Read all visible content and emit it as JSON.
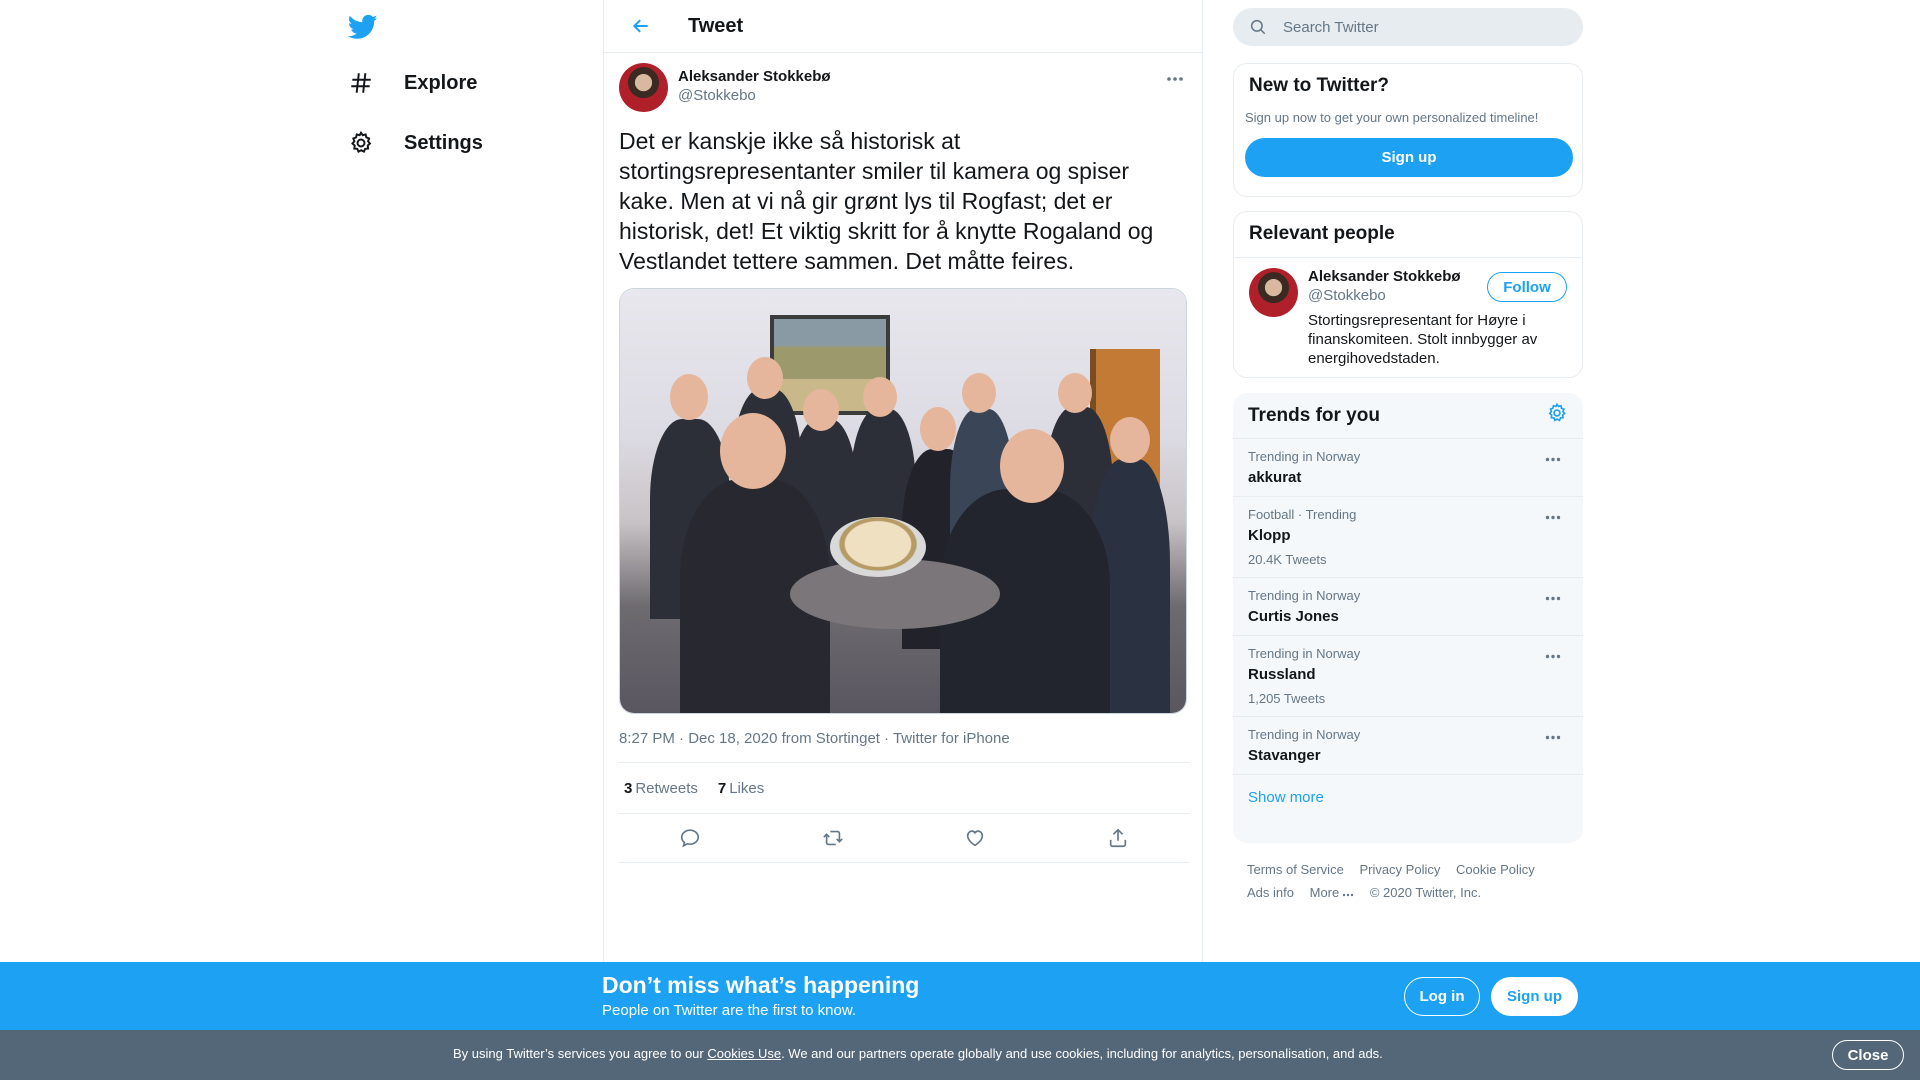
{
  "nav": {
    "explore_label": "Explore",
    "settings_label": "Settings"
  },
  "header": {
    "title": "Tweet"
  },
  "tweet": {
    "author_name": "Aleksander Stokkebø",
    "author_handle": "@Stokkebo",
    "text": "Det er kanskje ikke så historisk at stortingsrepresentanter smiler til kamera og spiser kake. Men at vi nå gir grønt lys til Rogfast; det er historisk, det! Et viktig skritt for å knytte Rogaland og Vestlandet tettere sammen. Det måtte feires.",
    "timestamp": "8:27 PM · Dec 18, 2020 from Stortinget",
    "source": "Twitter for iPhone",
    "retweet_count": "3",
    "retweet_label": "Retweets",
    "like_count": "7",
    "like_label": "Likes"
  },
  "search": {
    "placeholder": "Search Twitter"
  },
  "new_to_twitter": {
    "title": "New to Twitter?",
    "subtitle": "Sign up now to get your own personalized timeline!",
    "signup_label": "Sign up"
  },
  "relevant": {
    "title": "Relevant people",
    "name": "Aleksander Stokkebø",
    "handle": "@Stokkebo",
    "follow_label": "Follow",
    "bio": "Stortingsrepresentant for Høyre i finanskomiteen. Stolt innbygger av energihovedstaden."
  },
  "trends": {
    "title": "Trends for you",
    "items": [
      {
        "meta": "Trending in Norway",
        "name": "akkurat",
        "count": ""
      },
      {
        "meta": "Football · Trending",
        "name": "Klopp",
        "count": "20.4K Tweets"
      },
      {
        "meta": "Trending in Norway",
        "name": "Curtis Jones",
        "count": ""
      },
      {
        "meta": "Trending in Norway",
        "name": "Russland",
        "count": "1,205 Tweets"
      },
      {
        "meta": "Trending in Norway",
        "name": "Stavanger",
        "count": ""
      }
    ],
    "show_more": "Show more"
  },
  "footer": {
    "terms": "Terms of Service",
    "privacy": "Privacy Policy",
    "cookie": "Cookie Policy",
    "ads": "Ads info",
    "more": "More",
    "copyright": "© 2020 Twitter, Inc."
  },
  "bottom_bar": {
    "title": "Don’t miss what’s happening",
    "subtitle": "People on Twitter are the first to know.",
    "login_label": "Log in",
    "signup_label": "Sign up"
  },
  "cookie_bar": {
    "text_before": "By using Twitter’s services you agree to our ",
    "link": "Cookies Use",
    "text_after": ". We and our partners operate globally and use cookies, including for analytics, personalisation, and ads.",
    "close_label": "Close"
  },
  "colors": {
    "accent": "#1da1f2",
    "cookie_bar": "#546778"
  }
}
